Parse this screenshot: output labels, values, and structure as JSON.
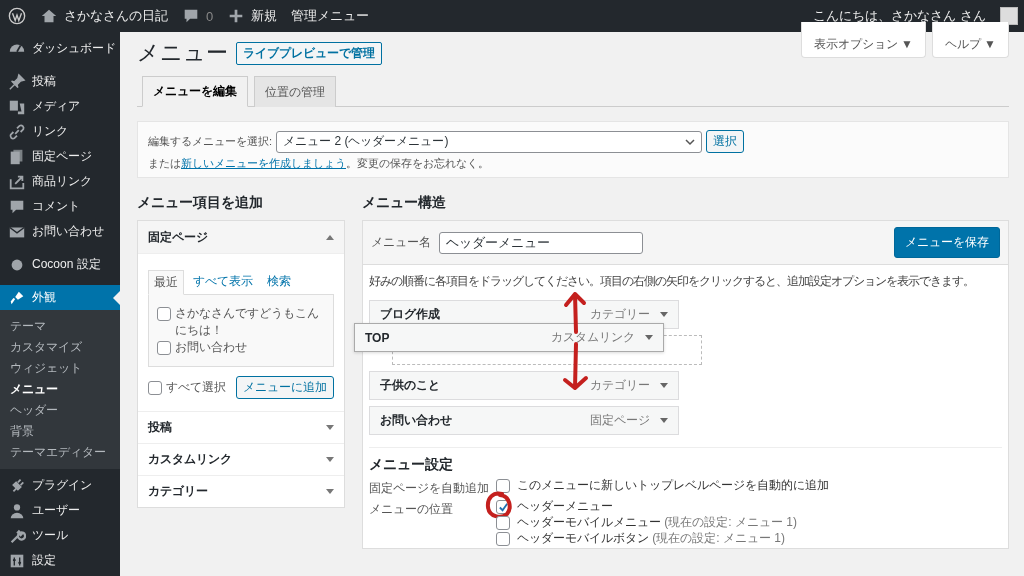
{
  "admin_bar": {
    "site_name": "さかなさんの日記",
    "comments": "0",
    "new": "新規",
    "menu": "管理メニュー",
    "greeting": "こんにちは、さかなさん さん"
  },
  "sidebar": {
    "items": [
      {
        "label": "ダッシュボード",
        "kind": "dashboard",
        "selected": false
      },
      {
        "label": "投稿",
        "kind": "pin",
        "selected": false
      },
      {
        "label": "メディア",
        "kind": "media",
        "selected": false
      },
      {
        "label": "リンク",
        "kind": "link",
        "selected": false
      },
      {
        "label": "固定ページ",
        "kind": "pages",
        "selected": false
      },
      {
        "label": "商品リンク",
        "kind": "share",
        "selected": false
      },
      {
        "label": "コメント",
        "kind": "comment",
        "selected": false
      },
      {
        "label": "お問い合わせ",
        "kind": "mail",
        "selected": false
      },
      {
        "label": "Cocoon 設定",
        "kind": "dot",
        "selected": false
      },
      {
        "label": "外観",
        "kind": "brush",
        "selected": true,
        "children": [
          {
            "label": "テーマ",
            "selected": false
          },
          {
            "label": "カスタマイズ",
            "selected": false
          },
          {
            "label": "ウィジェット",
            "selected": false
          },
          {
            "label": "メニュー",
            "selected": true
          },
          {
            "label": "ヘッダー",
            "selected": false
          },
          {
            "label": "背景",
            "selected": false
          },
          {
            "label": "テーマエディター",
            "selected": false
          }
        ]
      },
      {
        "label": "プラグイン",
        "kind": "plug",
        "selected": false
      },
      {
        "label": "ユーザー",
        "kind": "user",
        "selected": false
      },
      {
        "label": "ツール",
        "kind": "wrench",
        "selected": false
      },
      {
        "label": "設定",
        "kind": "sliders",
        "selected": false
      }
    ]
  },
  "page": {
    "title": "メニュー",
    "live_preview": "ライブプレビューで管理",
    "screen_options": "表示オプション ▼",
    "help": "ヘルプ ▼",
    "tabs": [
      {
        "label": "メニューを編集",
        "selected": true
      },
      {
        "label": "位置の管理",
        "selected": false
      }
    ]
  },
  "select_bar": {
    "label": "編集するメニューを選択:",
    "value": "メニュー 2 (ヘッダーメニュー)",
    "button": "選択",
    "note_before": "または",
    "note_link": "新しいメニューを作成しましょう",
    "note_after": "。変更の保存をお忘れなく。"
  },
  "add_items": {
    "heading": "メニュー項目を追加",
    "panels": [
      {
        "title": "固定ページ",
        "expanded": true,
        "tabs": [
          {
            "label": "最近",
            "selected": true
          },
          {
            "label": "すべて表示",
            "selected": false
          },
          {
            "label": "検索",
            "selected": false
          }
        ],
        "items": [
          {
            "label": "さかなさんですどうもこんにちは！",
            "checked": false
          },
          {
            "label": "お問い合わせ",
            "checked": false
          }
        ],
        "select_all": {
          "label": "すべて選択",
          "checked": false
        },
        "add_button": "メニューに追加"
      },
      {
        "title": "投稿",
        "expanded": false
      },
      {
        "title": "カスタムリンク",
        "expanded": false
      },
      {
        "title": "カテゴリー",
        "expanded": false
      }
    ]
  },
  "structure": {
    "heading": "メニュー構造",
    "name_label": "メニュー名",
    "name_value": "ヘッダーメニュー",
    "save": "メニューを保存",
    "instructions": "好みの順番に各項目をドラッグしてください。項目の右側の矢印をクリックすると、追加設定オプションを表示できます。",
    "items": [
      {
        "title": "ブログ作成",
        "type": "カテゴリー",
        "kind": "item"
      },
      {
        "title": "TOP",
        "type": "カスタムリンク",
        "kind": "dragging"
      },
      {
        "title": "子供のこと",
        "type": "カテゴリー",
        "kind": "item"
      },
      {
        "title": "お問い合わせ",
        "type": "固定ページ",
        "kind": "item"
      }
    ]
  },
  "settings": {
    "heading": "メニュー設定",
    "rows": [
      {
        "label": "固定ページを自動追加",
        "options": [
          {
            "label": "このメニューに新しいトップレベルページを自動的に追加",
            "checked": false
          }
        ]
      },
      {
        "label": "メニューの位置",
        "options": [
          {
            "label": "ヘッダーメニュー",
            "checked": true,
            "circled": true
          },
          {
            "label": "ヘッダーモバイルメニュー",
            "note": "(現在の設定: メニュー 1)",
            "checked": false
          },
          {
            "label": "ヘッダーモバイルボタン",
            "note": "(現在の設定: メニュー 1)",
            "checked": false
          }
        ]
      }
    ]
  }
}
